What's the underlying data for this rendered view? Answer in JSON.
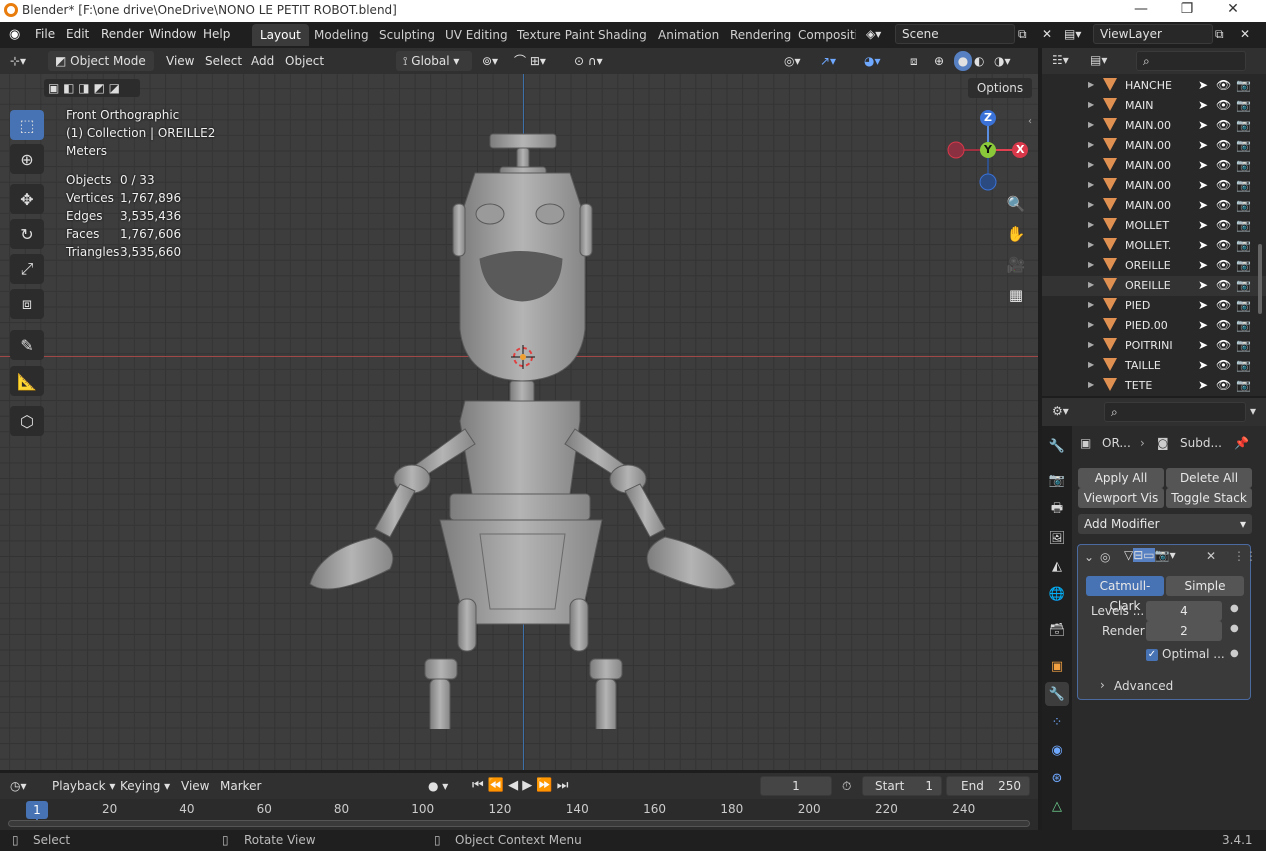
{
  "window": {
    "title": "Blender* [F:\\one drive\\OneDrive\\NONO LE PETIT ROBOT.blend]"
  },
  "menu": [
    "File",
    "Edit",
    "Render",
    "Window",
    "Help"
  ],
  "workspaces": [
    "Layout",
    "Modeling",
    "Sculpting",
    "UV Editing",
    "Texture Paint",
    "Shading",
    "Animation",
    "Rendering",
    "Compositin"
  ],
  "scene": "Scene",
  "view_layer": "ViewLayer",
  "viewport_header": {
    "mode": "Object Mode",
    "view": "View",
    "select": "Select",
    "add": "Add",
    "object": "Object",
    "orientation": "Global",
    "options": "Options"
  },
  "viewport_info": {
    "view_name": "Front Orthographic",
    "collection": "(1) Collection | OREILLE2",
    "units": "Meters",
    "stats": [
      {
        "label": "Objects",
        "value": "0 / 33"
      },
      {
        "label": "Vertices",
        "value": "1,767,896"
      },
      {
        "label": "Edges",
        "value": "3,535,436"
      },
      {
        "label": "Faces",
        "value": "1,767,606"
      },
      {
        "label": "Triangles",
        "value": "3,535,660"
      }
    ]
  },
  "gizmo": {
    "z": "Z",
    "y": "Y",
    "x": "X"
  },
  "outliner_items": [
    "HANCHE",
    "MAIN",
    "MAIN.00",
    "MAIN.00",
    "MAIN.00",
    "MAIN.00",
    "MAIN.00",
    "MOLLET",
    "MOLLET.",
    "OREILLE",
    "OREILLE",
    "PIED",
    "PIED.00",
    "POITRINI",
    "TAILLE",
    "TETE"
  ],
  "properties": {
    "breadcrumb_obj": "OR...",
    "breadcrumb_mod": "Subd...",
    "apply_all": "Apply All",
    "delete_all": "Delete All",
    "viewport_vis": "Viewport Vis",
    "toggle_stack": "Toggle Stack",
    "add_modifier": "Add Modifier",
    "catmull": "Catmull-Clark",
    "simple": "Simple",
    "levels_label": "Levels ...",
    "levels_value": "4",
    "render_label": "Render",
    "render_value": "2",
    "optimal": "Optimal ...",
    "advanced": "Advanced"
  },
  "timeline": {
    "playback": "Playback",
    "keying": "Keying",
    "view": "View",
    "marker": "Marker",
    "current_frame": "1",
    "start_label": "Start",
    "start": "1",
    "end_label": "End",
    "end": "250",
    "ticks": [
      "20",
      "40",
      "60",
      "80",
      "100",
      "120",
      "140",
      "160",
      "180",
      "200",
      "220",
      "240"
    ],
    "cursor_frame": "1"
  },
  "status": {
    "select": "Select",
    "rotate": "Rotate View",
    "context": "Object Context Menu",
    "version": "3.4.1"
  }
}
